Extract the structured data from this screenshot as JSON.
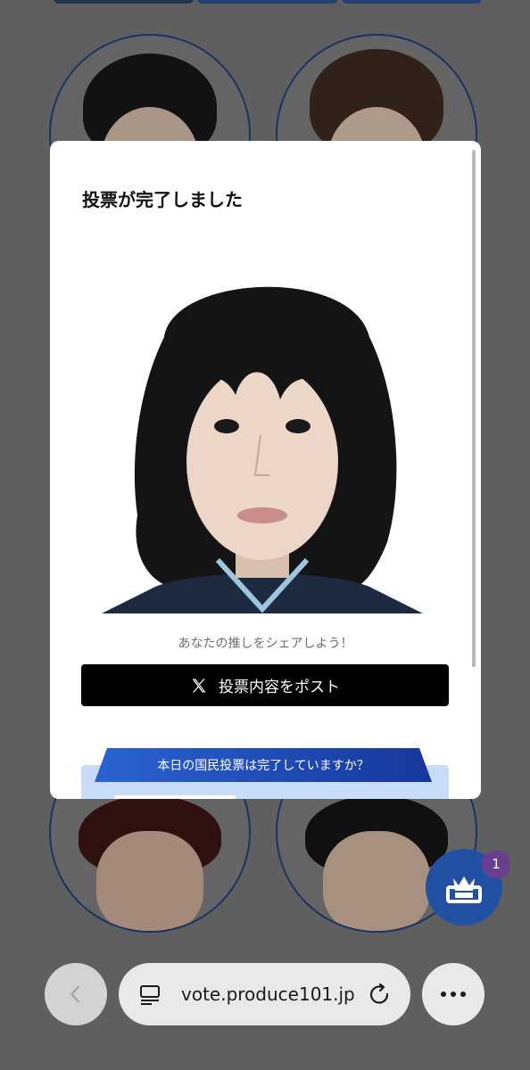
{
  "modal": {
    "title": "投票が完了しました",
    "share_prompt": "あなたの推しをシェアしよう！",
    "post_button_label": "投票内容をポスト",
    "vote_banner": "本日の国民投票は完了していますか？"
  },
  "notification": {
    "count": "1"
  },
  "browser": {
    "url": "vote.produce101.jp"
  },
  "icons": [
    "x-logo-icon",
    "crown-box-icon",
    "back-chevron-icon",
    "tabs-icon",
    "reload-icon",
    "more-icon"
  ],
  "colors": {
    "accent": "#2251a3",
    "badge": "#6b3f8f",
    "post_button": "#000000"
  }
}
